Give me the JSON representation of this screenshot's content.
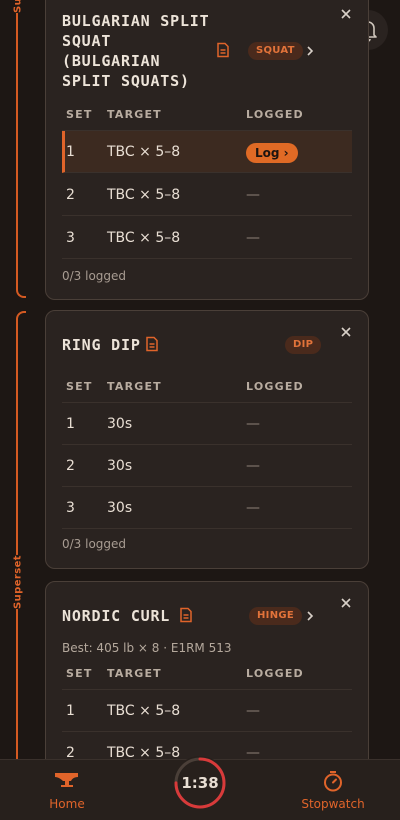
{
  "colors": {
    "background": "#1d1714",
    "card": "#2a2320",
    "accent": "#e0642a",
    "pill_bg": "#4a2a1c"
  },
  "supersets": [
    {
      "label": "Superset"
    },
    {
      "label": "Superset"
    }
  ],
  "table_headers": {
    "set": "SET",
    "target": "TARGET",
    "logged": "LOGGED"
  },
  "exercises": [
    {
      "title_line1": "BULGARIAN SPLIT",
      "title_line2": "SQUAT",
      "title_line3": "(BULGARIAN",
      "title_line4": "SPLIT SQUATS)",
      "tag": "SQUAT",
      "rows": [
        {
          "set": "1",
          "target": "TBC × 5–8",
          "logged": "Log ›"
        },
        {
          "set": "2",
          "target": "TBC × 5–8",
          "logged": "—"
        },
        {
          "set": "3",
          "target": "TBC × 5–8",
          "logged": "—"
        }
      ],
      "progress": "0/3 logged"
    },
    {
      "title_line1": "RING DIP",
      "tag": "DIP",
      "rows": [
        {
          "set": "1",
          "target": "30s",
          "logged": "—"
        },
        {
          "set": "2",
          "target": "30s",
          "logged": "—"
        },
        {
          "set": "3",
          "target": "30s",
          "logged": "—"
        }
      ],
      "progress": "0/3 logged"
    },
    {
      "title_line1": "NORDIC CURL",
      "tag": "HINGE",
      "best": "Best: 405 lb × 8 · E1RM 513",
      "rows": [
        {
          "set": "1",
          "target": "TBC × 5–8",
          "logged": "—"
        },
        {
          "set": "2",
          "target": "TBC × 5–8",
          "logged": "—"
        }
      ]
    }
  ],
  "bottom_nav": {
    "home_label": "Home",
    "timer": "1:38",
    "timer_progress": 0.75,
    "stopwatch_label": "Stopwatch"
  }
}
